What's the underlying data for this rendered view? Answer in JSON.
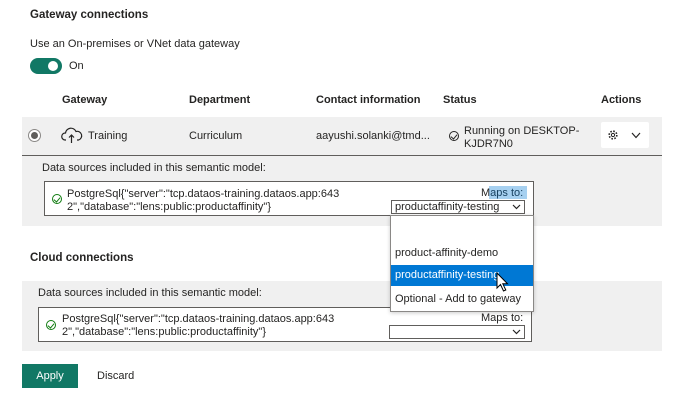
{
  "gateway_section": {
    "title": "Gateway connections",
    "toggle_label": "Use an On-premises or VNet data gateway",
    "toggle_state": "On",
    "columns": [
      "Gateway",
      "Department",
      "Contact information",
      "Status",
      "Actions"
    ],
    "row": {
      "gateway": "Training",
      "department": "Curriculum",
      "contact": "aayushi.solanki@tmd...",
      "status_line1": "Running on DESKTOP-",
      "status_line2": "KJDR7N0"
    },
    "sources_title": "Data sources included in this semantic model:",
    "source_line1": "PostgreSql{\"server\":\"tcp.dataos-training.dataos.app:643",
    "source_line2": "2\",\"database\":\"lens:public:productaffinity\"}",
    "maps_to_label": "Maps to:",
    "maps_to_value": "productaffinity-testing",
    "dropdown_options": [
      "",
      "product-affinity-demo",
      "productaffinity-testing",
      "Optional - Add to gateway"
    ],
    "dropdown_selected_index": 2
  },
  "cloud_section": {
    "title": "Cloud connections",
    "sources_title": "Data sources included in this semantic model:",
    "source_line1": "PostgreSql{\"server\":\"tcp.dataos-training.dataos.app:643",
    "source_line2": "2\",\"database\":\"lens:public:productaffinity\"}",
    "maps_to_label": "Maps to:",
    "maps_to_value": ""
  },
  "footer": {
    "apply_label": "Apply",
    "discard_label": "Discard"
  },
  "colors": {
    "accent": "#117865",
    "selection": "#0078d4",
    "row_background": "#f0f0f0"
  }
}
